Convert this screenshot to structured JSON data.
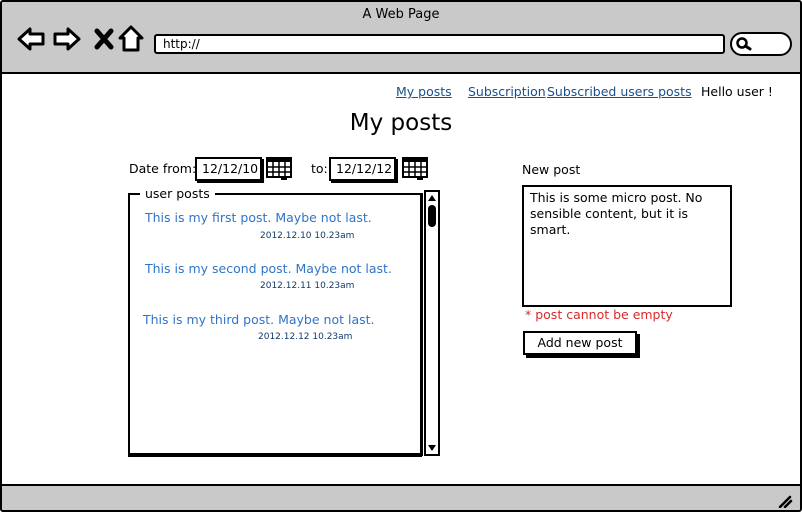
{
  "window": {
    "title": "A Web Page"
  },
  "browser": {
    "url": "http://",
    "icons": [
      "back-icon",
      "forward-icon",
      "close-icon",
      "home-icon",
      "search-icon",
      "resize-grip-icon"
    ]
  },
  "nav": {
    "links": [
      {
        "label": "My posts"
      },
      {
        "label": "Subscription"
      },
      {
        "label": "Subscribed users posts"
      }
    ],
    "greeting": "Hello user !"
  },
  "page": {
    "title": "My posts"
  },
  "filter": {
    "from_label": "Date from:",
    "from_value": "12/12/10",
    "to_label": "to:",
    "to_value": "12/12/12"
  },
  "posts_panel": {
    "legend": "user posts",
    "posts": [
      {
        "text": "This is my first post. Maybe not last.",
        "date": "2012.12.10 10.23am"
      },
      {
        "text": "This is my second post. Maybe not last.",
        "date": "2012.12.11 10.23am"
      },
      {
        "text": "This is my third post. Maybe not last.",
        "date": "2012.12.12 10.23am"
      }
    ]
  },
  "new_post": {
    "label": "New post",
    "content": "This is some micro post. No sensible content, but it is smart.",
    "error": "* post cannot be empty",
    "button": "Add new post"
  },
  "colors": {
    "chrome": "#c9c9c9",
    "link": "#1a4f8c",
    "post_link": "#2f75c8",
    "error": "#d62b2b"
  }
}
